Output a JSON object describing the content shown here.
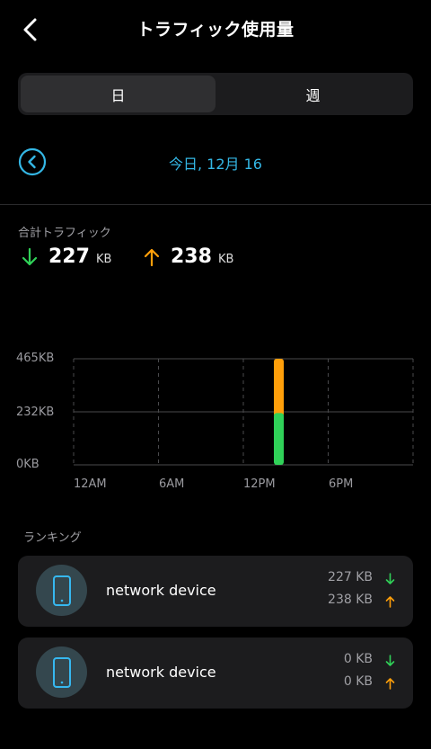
{
  "header": {
    "title": "トラフィック使用量"
  },
  "tabs": [
    {
      "label": "日"
    },
    {
      "label": "週"
    }
  ],
  "date": {
    "label": "今日, 12月 16"
  },
  "totals": {
    "label": "合計トラフィック",
    "download_value": "227",
    "download_unit": "KB",
    "upload_value": "238",
    "upload_unit": "KB"
  },
  "chart_data": {
    "type": "bar",
    "y_tick_labels": [
      "465KB",
      "232KB",
      "0KB"
    ],
    "x_tick_labels": [
      "12AM",
      "6AM",
      "12PM",
      "6PM"
    ],
    "ylim": [
      0,
      465
    ],
    "bars": [
      {
        "hour": 12,
        "download_kb": 227,
        "upload_kb": 238
      }
    ],
    "colors": {
      "download": "#30d158",
      "upload": "#ff9f0a"
    },
    "grid": true
  },
  "ranking": {
    "label": "ランキング",
    "items": [
      {
        "name": "network device",
        "download": "227 KB",
        "upload": "238 KB"
      },
      {
        "name": "network device",
        "download": "0 KB",
        "upload": "0 KB"
      }
    ]
  },
  "colors": {
    "accent": "#34b7e5",
    "download": "#30d158",
    "upload": "#ff9f0a",
    "card": "#1c1c1e"
  }
}
